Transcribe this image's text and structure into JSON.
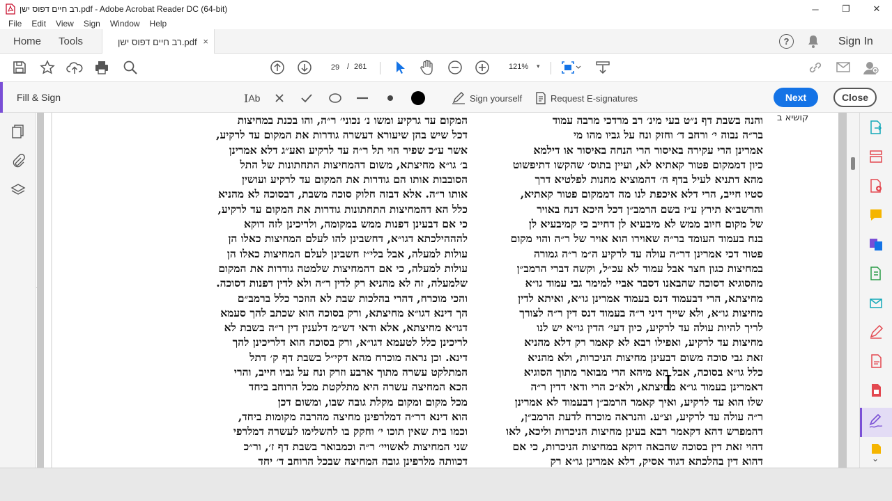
{
  "window": {
    "title": "רב חיים דפוס ישן.pdf - Adobe Acrobat Reader DC (64-bit)",
    "minimize": "─",
    "restore": "❐",
    "close": "✕"
  },
  "menu": [
    "File",
    "Edit",
    "View",
    "Sign",
    "Window",
    "Help"
  ],
  "tabs": {
    "home": "Home",
    "tools": "Tools",
    "document": "רב חיים דפוס ישן.pdf",
    "close_glyph": "×",
    "help": "?",
    "sign_in": "Sign In"
  },
  "toolbar": {
    "page_current": "29",
    "page_separator": "/",
    "page_total": "261",
    "zoom": "121%",
    "zoom_arrow": "▾"
  },
  "fill_sign": {
    "title": "Fill & Sign",
    "text_tool": "Ab",
    "sign_yourself": "Sign yourself",
    "request_esignatures": "Request E-signatures",
    "next": "Next",
    "close": "Close"
  },
  "document": {
    "margin_note": "קושיא ב",
    "right_column": [
      "והנה בשבת דף נ״ט בעי מינ׳ רב מרדכי מרבה עמוד",
      "בר״ה נבוה י׳ ורחב ד׳ וחזק ונח על גביו מהו מי",
      "אמרינן הרי עקירה באיסור הרי הנחה באיסור או דילמא",
      "כיון דממקום פטור קאתיא לא, ועיין בתוס׳ שהקשו דתיפשוט",
      "מהא דתניא לעיל בדף ה׳ דהמוציא מחנות לפלטיא דרך",
      "סטיו חייב, הרי דלא איכפת לנו מה דממקום פטור קאתיא,",
      "והרשב״א תירץ ע״ז בשם הרמב״ן דכל היכא דנח באויר",
      "של מקום חיוב ממש לא מיבעיא לן דחייב כי קמיבעיא לן",
      "בנח בעמוד העומד בר״ה שאוירו הוא אויר של ר״ה והוי מקום",
      "פטור דכי אמרינן דר״ה עולה עד לרקיע ה״מ ר״ה גמורה",
      "במחיצות כגון חצר אבל עמוד לא עכ״ל, וקשה דברי הרמב״ן",
      "מהסוגיא דסוכה שהבאנו דסבר אביי למימר גבי עמוד גו״א",
      "מחיצתא, הרי דבעמוד דנס בעמוד אמרינן גו״א, ואיתא לדין",
      "מחיצות גו״א, ולא שייך דיני ר״ה בעמוד דנס דין ר״ה לצורך",
      "לריך להיות עולה עד לרקיע, כיון דעי׳ הדין גו״א יש לנו",
      "מחיצות עד לרקיע, ואפילו רבא לא קאמר רק דלא מהניא",
      "זאת גבי סוכה משום דבעינן מחיצות הניכרות, ולא מהניא",
      "כלל גו״א בסוכה, אבל הא מיהא הרי מבואר מתוך הסוגיא",
      "דאמרינן בעמוד גו״א מחיצתא, ולא״כ הרי ודאי דדין ר״ה",
      "שלו הוא עד לרקיע, ואיך קאמר הרמב״ן דבעמוד לא אמרינן",
      "ר״ה עולה עד לרקיע, וצ״ע. והנראה מוכרח לדעת הרמב״ן,",
      "דהמפרש דהא דקאמר רבא בעינן מחיצות הניכרות וליכא, לאו",
      "דהוי זאת דין בסוכה שהבאה דוקא במחיצות הניכרות, כי אם",
      "דהוא דין בהלכתא דגוד אסיק, דלא אמרינן גו״א רק"
    ],
    "left_column": [
      "המקום עד גרקיע ומשו נ׳ נכוני׳ ר״ה, והו בכנת במחיצות",
      "דכל שיש בהן שיעורא דעשרה גודרות את המקום עד לרקיע,",
      "אשר ע״כ שפיר הוי תל ר״ה עד לרקיע ואע״ג דלא אמרינן",
      "ב׳ גו״א מחיצתא, משום דהמחיצות התחתונות של התל",
      "הסובבות אותו הם גודרות את המקום עד לרקיע ועושין",
      "אותו ר״ה. אלא דבזה חלוק סוכה משבת, דבסוכה לא מהניא",
      "כלל הא דהמחיצות התחתונות גודרות את המקום עד לרקיע,",
      "כי אם דבעינן דפנות ממש במקומה, ולריכינן לזה דוקא",
      "להההילכתא דגו״א, דחשבינן להו לעלם המחיצות כאלו הן",
      "עולות למעלה, אבל בלי״ז חשבינן לעלם המחיצות כאלו הן",
      "עולות למעלה, כי אם דהמחיצות שלמטה גודרות את המקום",
      "שלמעלה, זה לא מהניא רק לדין ר״ה ולא לדין דפנות דסוכה.",
      "והכי מוכרח, דהרי בהלכות שבת לא הוזכר כלל ברמב״ם",
      "הך דינא דגו״א מחיצתא, ורק בסוכה הוא שכתב להך סעמא",
      "דגו״א מחיצתא, אלא ודאי דש״מ דלענין דין ר״ה בשבת לא",
      "לריכינן כלל לטעמא דגו״א, ורק בסוכה הוא דלריכינן להך",
      "דינא. וכן נראה מוכרח מהא דקי״ל בשבת דף ק׳ דתל",
      "המתלקט עשרה מתוך ארבע וזרק ונח על גביו חייב, והרי",
      "הכא המחיצה עשרה היא מתלקטת מכל הרוחב ביחד",
      "מכל מקום ומקום מקלת גובה שבו, ומשום דכן",
      "הוא דינא דר״ה דמלרפינן מחיצה מהרבה מקומות ביחד,",
      "וכמו בית שאין תוכו י׳ וחקק בו להשלימו לעשרה דמלרפי",
      "שני המחיצות לאשויי׳ ר״ה וכמבואר בשבת דף ז׳, ור״כ",
      "דכוותה מלרפינן גובה המחיצה שבכל הרוחב ד׳ יחד"
    ]
  },
  "colors": {
    "accent_purple": "#7a4fd6",
    "next_blue": "#1473e6"
  }
}
